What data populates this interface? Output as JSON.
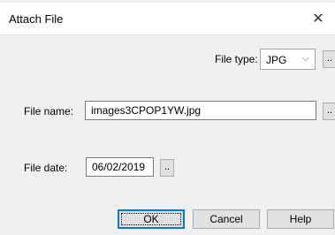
{
  "window": {
    "title": "Attach File",
    "close_glyph": "✕"
  },
  "file_type": {
    "label": "File type:",
    "value": "JPG",
    "chevron_glyph": "⌵",
    "browse_label": ".."
  },
  "file_name": {
    "label": "File name:",
    "value": "images3CPOP1YW.jpg",
    "browse_label": ".."
  },
  "file_date": {
    "label": "File date:",
    "value": "06/02/2019",
    "picker_label": ".."
  },
  "buttons": {
    "ok": "OK",
    "cancel": "Cancel",
    "help": "Help"
  },
  "colors": {
    "accent": "#0078d7",
    "dialog_bg": "#f0f0f0",
    "button_bg": "#e1e1e1"
  }
}
